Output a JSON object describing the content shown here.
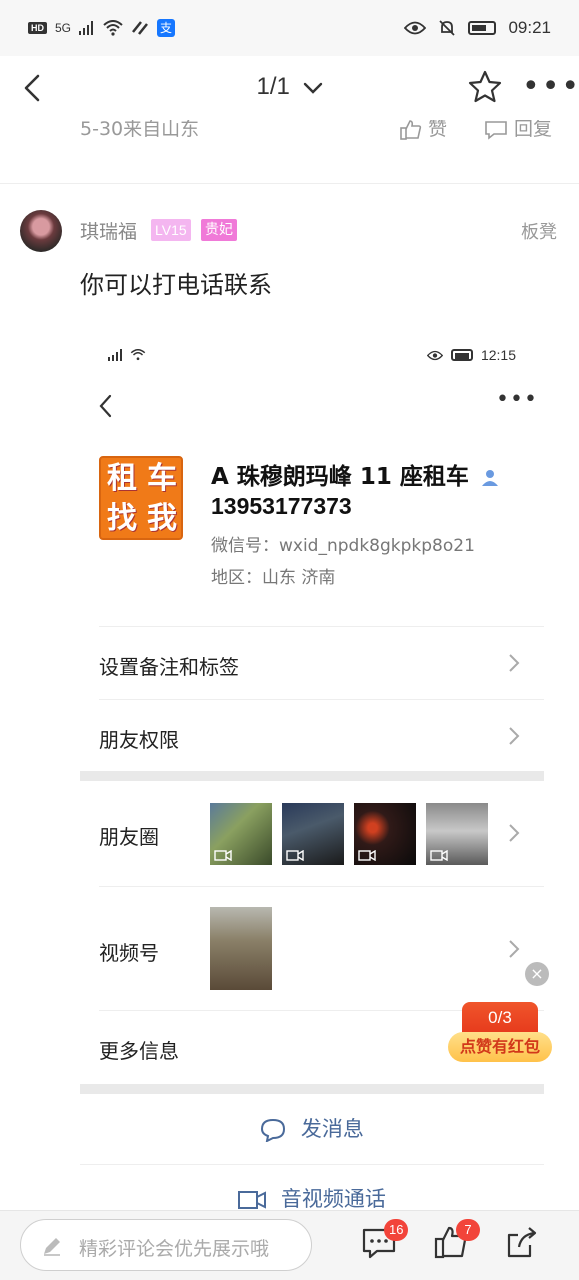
{
  "status_bar": {
    "time": "09:21",
    "network": "5G",
    "hd": "HD",
    "alipay_glyph": "支"
  },
  "nav": {
    "page_indicator": "1/1",
    "icons": [
      "back-arrow-icon",
      "chevron-down-icon",
      "star-icon",
      "more-icon"
    ]
  },
  "previous_comment": {
    "meta": "5-30来自山东",
    "like_label": "赞",
    "reply_label": "回复"
  },
  "comment": {
    "username": "琪瑞福",
    "level": "LV15",
    "title_badge": "贵妃",
    "floor": "板凳",
    "text": "你可以打电话联系"
  },
  "embedded_screenshot": {
    "status_time": "12:15",
    "logo_chars": [
      "租",
      "车",
      "找",
      "我"
    ],
    "contact_name": "A 珠穆朗玛峰 11 座租车",
    "phone": "13953177373",
    "wechat_id": "微信号：wxid_npdk8gkpkp8o21",
    "region": "地区：山东  济南",
    "rows": {
      "remark": "设置备注和标签",
      "permission": "朋友权限",
      "moments": "朋友圈",
      "channels": "视频号",
      "more_info": "更多信息"
    },
    "send_message": "发消息",
    "av_call": "音视频通话"
  },
  "red_packet": {
    "count": "0/3",
    "label": "点赞有红包",
    "close": "×"
  },
  "bottom_bar": {
    "comment_placeholder": "精彩评论会优先展示哦",
    "comment_count": "16",
    "like_count": "7"
  },
  "colors": {
    "level_badge": "#f4b6f0",
    "title_badge": "#f07ad8",
    "link_blue": "#4a6a9a",
    "badge_red": "#f2443a",
    "packet_red": "#e63a1c",
    "logo_orange": "#f07a18"
  }
}
